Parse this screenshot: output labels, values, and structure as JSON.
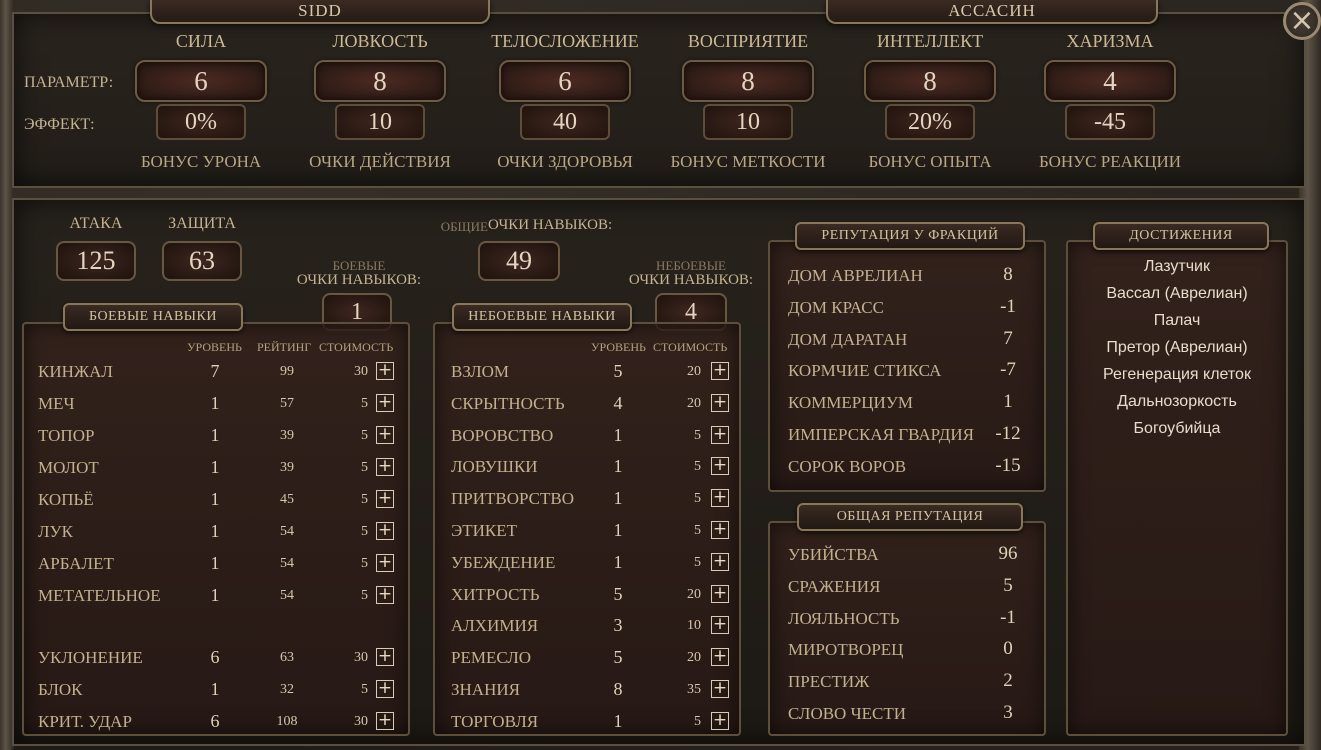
{
  "header": {
    "character_name": "SIDD",
    "character_class": "АССАСИН",
    "close_glyph": "×"
  },
  "attributes": {
    "row_param_label": "ПАРАМЕТР:",
    "row_effect_label": "ЭФФЕКТ:",
    "items": [
      {
        "name": "СИЛА",
        "value": "6",
        "effect": "0%",
        "bonus": "БОНУС УРОНА"
      },
      {
        "name": "ЛОВКОСТЬ",
        "value": "8",
        "effect": "10",
        "bonus": "ОЧКИ ДЕЙСТВИЯ"
      },
      {
        "name": "ТЕЛОСЛОЖЕНИЕ",
        "value": "6",
        "effect": "40",
        "bonus": "ОЧКИ ЗДОРОВЬЯ"
      },
      {
        "name": "ВОСПРИЯТИЕ",
        "value": "8",
        "effect": "10",
        "bonus": "БОНУС МЕТКОСТИ"
      },
      {
        "name": "ИНТЕЛЛЕКТ",
        "value": "8",
        "effect": "20%",
        "bonus": "БОНУС ОПЫТА"
      },
      {
        "name": "ХАРИЗМА",
        "value": "4",
        "effect": "-45",
        "bonus": "БОНУС РЕАКЦИИ"
      }
    ]
  },
  "combat_stats": {
    "attack_label": "АТАКА",
    "attack_value": "125",
    "defense_label": "ЗАЩИТА",
    "defense_value": "63"
  },
  "skill_points": {
    "general_prefix": "ОБЩИЕ",
    "general_label": "ОЧКИ НАВЫКОВ:",
    "general_value": "49",
    "combat_prefix": "БОЕВЫЕ",
    "combat_label": "ОЧКИ НАВЫКОВ:",
    "combat_value": "1",
    "noncombat_prefix": "НЕБОЕВЫЕ",
    "noncombat_label": "ОЧКИ НАВЫКОВ:",
    "noncombat_value": "4"
  },
  "combat_skills": {
    "title": "БОЕВЫЕ НАВЫКИ",
    "col_level": "УРОВЕНЬ",
    "col_rating": "РЕЙТИНГ",
    "col_cost": "СТОИМОСТЬ",
    "rows": [
      {
        "name": "КИНЖАЛ",
        "level": "7",
        "rating": "99",
        "cost": "30"
      },
      {
        "name": "МЕЧ",
        "level": "1",
        "rating": "57",
        "cost": "5"
      },
      {
        "name": "ТОПОР",
        "level": "1",
        "rating": "39",
        "cost": "5"
      },
      {
        "name": "МОЛОТ",
        "level": "1",
        "rating": "39",
        "cost": "5"
      },
      {
        "name": "КОПЬЁ",
        "level": "1",
        "rating": "45",
        "cost": "5"
      },
      {
        "name": "ЛУК",
        "level": "1",
        "rating": "54",
        "cost": "5"
      },
      {
        "name": "АРБАЛЕТ",
        "level": "1",
        "rating": "54",
        "cost": "5"
      },
      {
        "name": "МЕТАТЕЛЬНОЕ",
        "level": "1",
        "rating": "54",
        "cost": "5"
      },
      {
        "name": "УКЛОНЕНИЕ",
        "level": "6",
        "rating": "63",
        "cost": "30"
      },
      {
        "name": "БЛОК",
        "level": "1",
        "rating": "32",
        "cost": "5"
      },
      {
        "name": "КРИТ. УДАР",
        "level": "6",
        "rating": "108",
        "cost": "30"
      }
    ]
  },
  "noncombat_skills": {
    "title": "НЕБОЕВЫЕ НАВЫКИ",
    "col_level": "УРОВЕНЬ",
    "col_cost": "СТОИМОСТЬ",
    "rows": [
      {
        "name": "ВЗЛОМ",
        "level": "5",
        "cost": "20"
      },
      {
        "name": "СКРЫТНОСТЬ",
        "level": "4",
        "cost": "20"
      },
      {
        "name": "ВОРОВСТВО",
        "level": "1",
        "cost": "5"
      },
      {
        "name": "ЛОВУШКИ",
        "level": "1",
        "cost": "5"
      },
      {
        "name": "ПРИТВОРСТВО",
        "level": "1",
        "cost": "5"
      },
      {
        "name": "ЭТИКЕТ",
        "level": "1",
        "cost": "5"
      },
      {
        "name": "УБЕЖДЕНИЕ",
        "level": "1",
        "cost": "5"
      },
      {
        "name": "ХИТРОСТЬ",
        "level": "5",
        "cost": "20"
      },
      {
        "name": "АЛХИМИЯ",
        "level": "3",
        "cost": "10"
      },
      {
        "name": "РЕМЕСЛО",
        "level": "5",
        "cost": "20"
      },
      {
        "name": "ЗНАНИЯ",
        "level": "8",
        "cost": "35"
      },
      {
        "name": "ТОРГОВЛЯ",
        "level": "1",
        "cost": "5"
      }
    ]
  },
  "faction_reputation": {
    "title": "РЕПУТАЦИЯ У ФРАКЦИЙ",
    "rows": [
      {
        "name": "ДОМ АВРЕЛИАН",
        "value": "8"
      },
      {
        "name": "ДОМ КРАСС",
        "value": "-1"
      },
      {
        "name": "ДОМ ДАРАТАН",
        "value": "7"
      },
      {
        "name": "КОРМЧИЕ СТИКСА",
        "value": "-7"
      },
      {
        "name": "КОММЕРЦИУМ",
        "value": "1"
      },
      {
        "name": "ИМПЕРСКАЯ ГВАРДИЯ",
        "value": "-12"
      },
      {
        "name": "СОРОК ВОРОВ",
        "value": "-15"
      }
    ]
  },
  "general_reputation": {
    "title": "ОБЩАЯ РЕПУТАЦИЯ",
    "rows": [
      {
        "name": "УБИЙСТВА",
        "value": "96"
      },
      {
        "name": "СРАЖЕНИЯ",
        "value": "5"
      },
      {
        "name": "ЛОЯЛЬНОСТЬ",
        "value": "-1"
      },
      {
        "name": "МИРОТВОРЕЦ",
        "value": "0"
      },
      {
        "name": "ПРЕСТИЖ",
        "value": "2"
      },
      {
        "name": "СЛОВО ЧЕСТИ",
        "value": "3"
      }
    ]
  },
  "achievements": {
    "title": "ДОСТИЖЕНИЯ",
    "items": [
      "Лазутчик",
      "Вассал (Аврелиан)",
      "Палач",
      "Претор (Аврелиан)",
      "Регенерация клеток",
      "Дальнозоркость",
      "Богоубийца"
    ]
  }
}
